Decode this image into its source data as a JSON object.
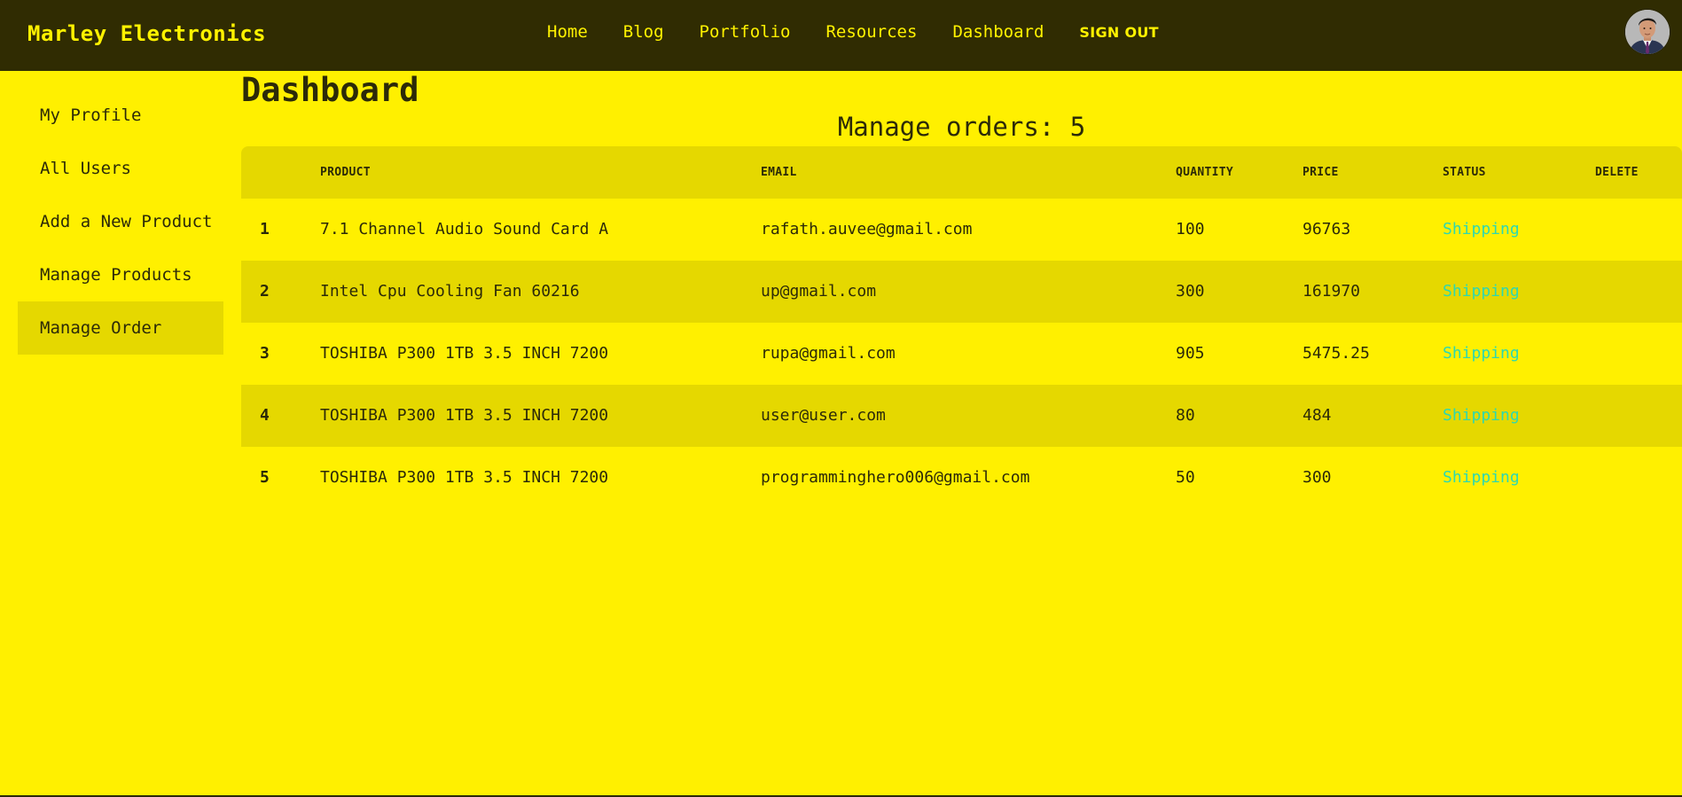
{
  "header": {
    "brand": "Marley Electronics",
    "nav": [
      "Home",
      "Blog",
      "Portfolio",
      "Resources",
      "Dashboard"
    ],
    "signout_label": "SIGN OUT"
  },
  "sidebar": {
    "items": [
      {
        "label": "My Profile"
      },
      {
        "label": "All Users"
      },
      {
        "label": "Add a New Product"
      },
      {
        "label": "Manage Products"
      },
      {
        "label": "Manage Order"
      }
    ],
    "active_index": 4
  },
  "main": {
    "title": "Dashboard",
    "subtitle": "Manage orders: 5",
    "columns": [
      "",
      "PRODUCT",
      "EMAIL",
      "QUANTITY",
      "PRICE",
      "STATUS",
      "DELETE"
    ],
    "rows": [
      {
        "no": "1",
        "product": "7.1 Channel Audio Sound Card A",
        "email": "rafath.auvee@gmail.com",
        "quantity": "100",
        "price": "96763",
        "status": "Shipping"
      },
      {
        "no": "2",
        "product": "Intel Cpu Cooling Fan 60216",
        "email": "up@gmail.com",
        "quantity": "300",
        "price": "161970",
        "status": "Shipping"
      },
      {
        "no": "3",
        "product": "TOSHIBA P300 1TB 3.5 INCH 7200",
        "email": "rupa@gmail.com",
        "quantity": "905",
        "price": "5475.25",
        "status": "Shipping"
      },
      {
        "no": "4",
        "product": "TOSHIBA P300 1TB 3.5 INCH 7200",
        "email": "user@user.com",
        "quantity": "80",
        "price": "484",
        "status": "Shipping"
      },
      {
        "no": "5",
        "product": "TOSHIBA P300 1TB 3.5 INCH 7200",
        "email": "programminghero006@gmail.com",
        "quantity": "50",
        "price": "300",
        "status": "Shipping"
      }
    ]
  },
  "colors": {
    "background": "#fff000",
    "header_bg": "#302c02",
    "accent_text": "#fff200",
    "row_alt": "#e5d800",
    "status": "#2ed8b0"
  }
}
